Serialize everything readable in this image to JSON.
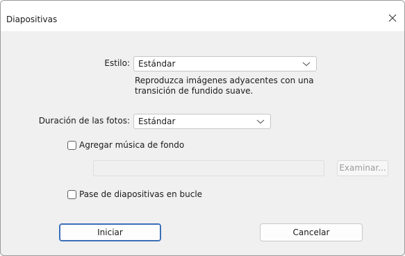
{
  "window": {
    "title": "Diapositivas",
    "close_icon": "close-icon"
  },
  "style": {
    "label": "Estilo:",
    "value": "Estándar",
    "description_line1": "Reproduzca imágenes adyacentes con una",
    "description_line2": "transición de fundido suave."
  },
  "duration": {
    "label": "Duración de las fotos:",
    "value": "Estándar"
  },
  "music": {
    "checkbox_label": "Agregar música de fondo",
    "checked": false,
    "path_value": "",
    "browse_label": "Examinar..."
  },
  "loop": {
    "checkbox_label": "Pase de diapositivas en bucle",
    "checked": false
  },
  "buttons": {
    "start_label": "Iniciar",
    "cancel_label": "Cancelar"
  },
  "colors": {
    "accent": "#3a6fb6",
    "dialog_bg": "#f0f0f0"
  }
}
